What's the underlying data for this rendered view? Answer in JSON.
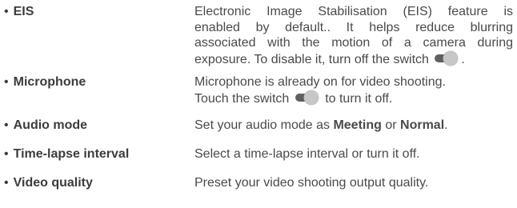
{
  "bullet": "•",
  "items": [
    {
      "term": "EIS",
      "desc_lines": [
        "Electronic Image Stabilisation (EIS) feature is",
        "enabled by default.. It helps reduce blurring",
        "associated with the motion of a camera during"
      ],
      "desc_last": "exposure.  To disable it, turn off the switch",
      "desc_after_toggle": "."
    },
    {
      "term": "Microphone",
      "desc_line1": "Microphone is already on for video shooting.",
      "desc_before_toggle": "Touch the switch",
      "desc_after_toggle": "to turn it off."
    },
    {
      "term": "Audio mode",
      "desc_prefix": "Set your audio mode as ",
      "desc_bold1": "Meeting",
      "desc_mid": " or ",
      "desc_bold2": "Normal",
      "desc_suffix": "."
    },
    {
      "term": "Time-lapse interval",
      "desc": "Select a time-lapse interval or turn it off."
    },
    {
      "term": "Video quality",
      "desc": "Preset your video shooting output quality."
    }
  ],
  "colors": {
    "text": "#4a4a4a",
    "toggle_track": "#5f5f5f",
    "toggle_knob": "#c7c7c7"
  },
  "icons": {
    "switch": "toggle-switch-icon"
  }
}
